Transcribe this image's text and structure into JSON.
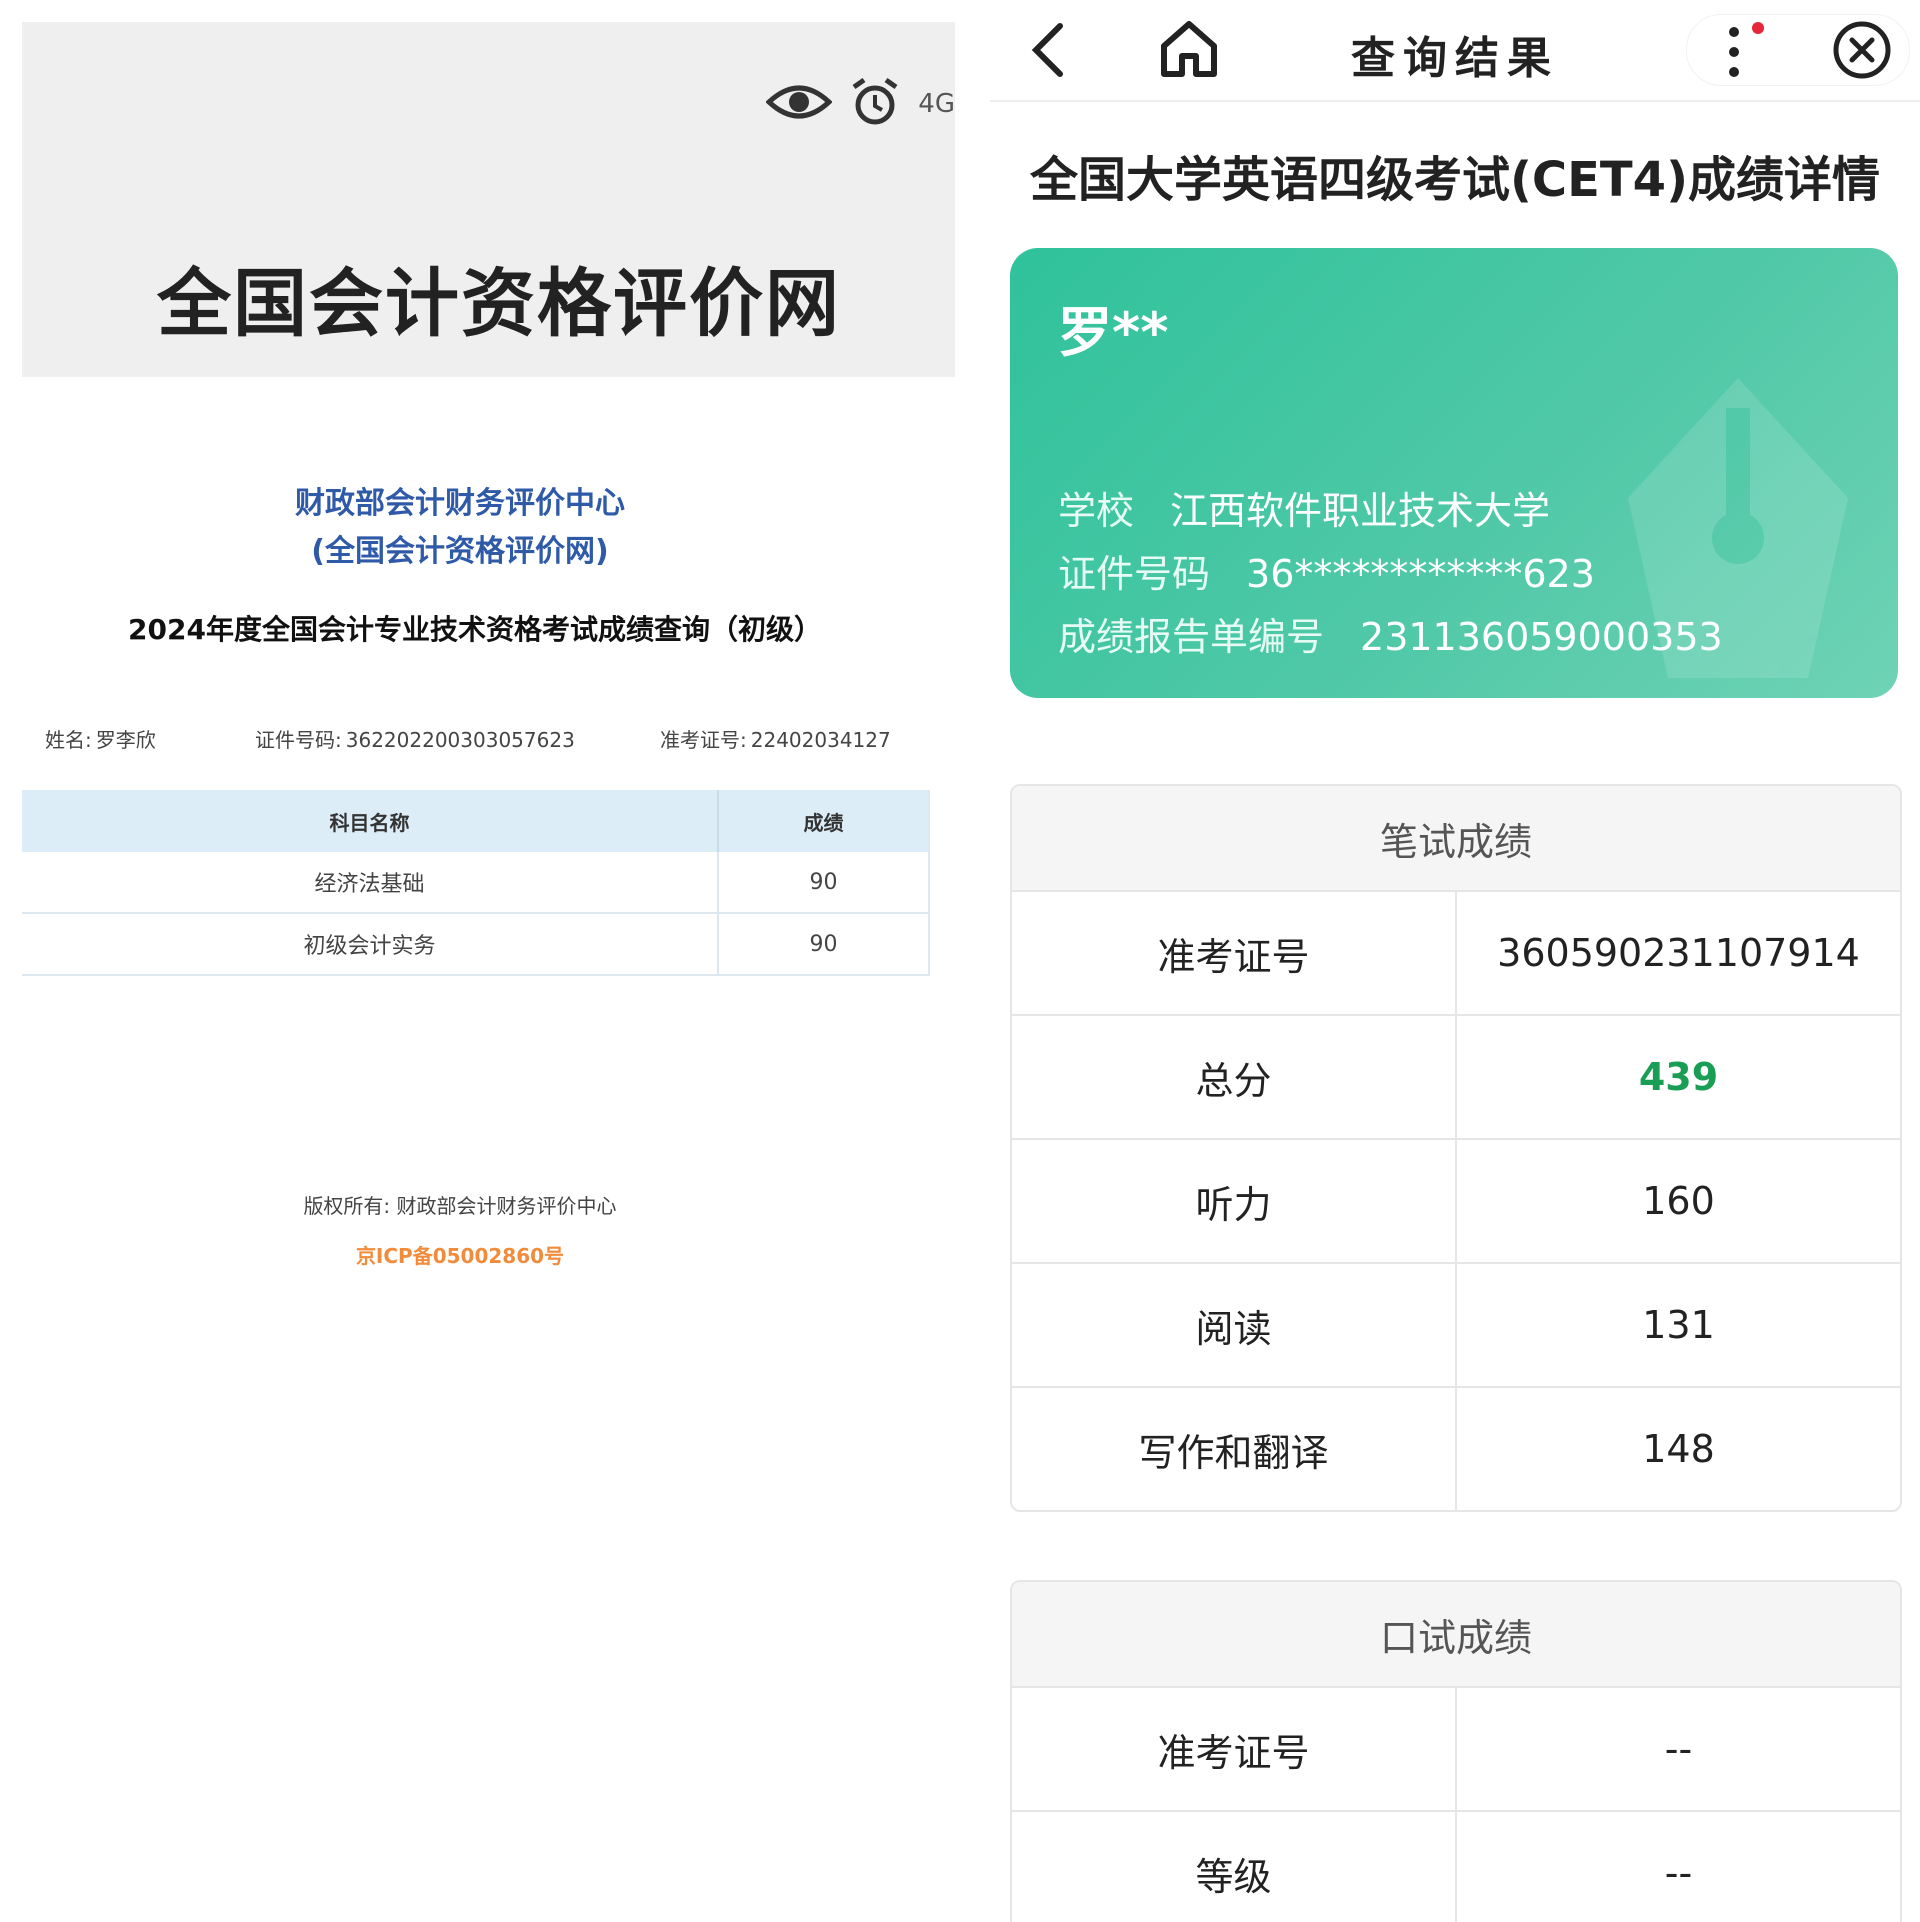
{
  "left": {
    "status": {
      "network": "4G"
    },
    "site_title": "全国会计资格评价网",
    "org_line1": "财政部会计财务评价中心",
    "org_line2": "(全国会计资格评价网)",
    "exam_title": "2024年度全国会计专业技术资格考试成绩查询（初级）",
    "info": {
      "name_label": "姓名:",
      "name_value": "罗李欣",
      "id_label": "证件号码:",
      "id_value": "362202200303057623",
      "ticket_label": "准考证号:",
      "ticket_value": "22402034127"
    },
    "table": {
      "headers": [
        "科目名称",
        "成绩"
      ],
      "rows": [
        {
          "subject": "经济法基础",
          "score": "90"
        },
        {
          "subject": "初级会计实务",
          "score": "90"
        }
      ]
    },
    "copyright": "版权所有: 财政部会计财务评价中心",
    "icp": "京ICP备05002860号"
  },
  "right": {
    "nav": {
      "title": "查询结果"
    },
    "page_title": "全国大学英语四级考试(CET4)成绩详情",
    "card": {
      "name": "罗**",
      "school_label": "学校",
      "school_value": "江西软件职业技术大学",
      "id_label": "证件号码",
      "id_value": "36************623",
      "report_label": "成绩报告单编号",
      "report_value": "231136059000353"
    },
    "written": {
      "heading": "笔试成绩",
      "rows": [
        {
          "label": "准考证号",
          "value": "360590231107914"
        },
        {
          "label": "总分",
          "value": "439"
        },
        {
          "label": "听力",
          "value": "160"
        },
        {
          "label": "阅读",
          "value": "131"
        },
        {
          "label": "写作和翻译",
          "value": "148"
        }
      ]
    },
    "oral": {
      "heading": "口试成绩",
      "rows": [
        {
          "label": "准考证号",
          "value": "--"
        },
        {
          "label": "等级",
          "value": "--"
        }
      ]
    },
    "colors": {
      "card": "#2fc29b",
      "total_score": "#1a9e55",
      "icp": "#f08c3c",
      "org": "#2f5aa8"
    }
  }
}
